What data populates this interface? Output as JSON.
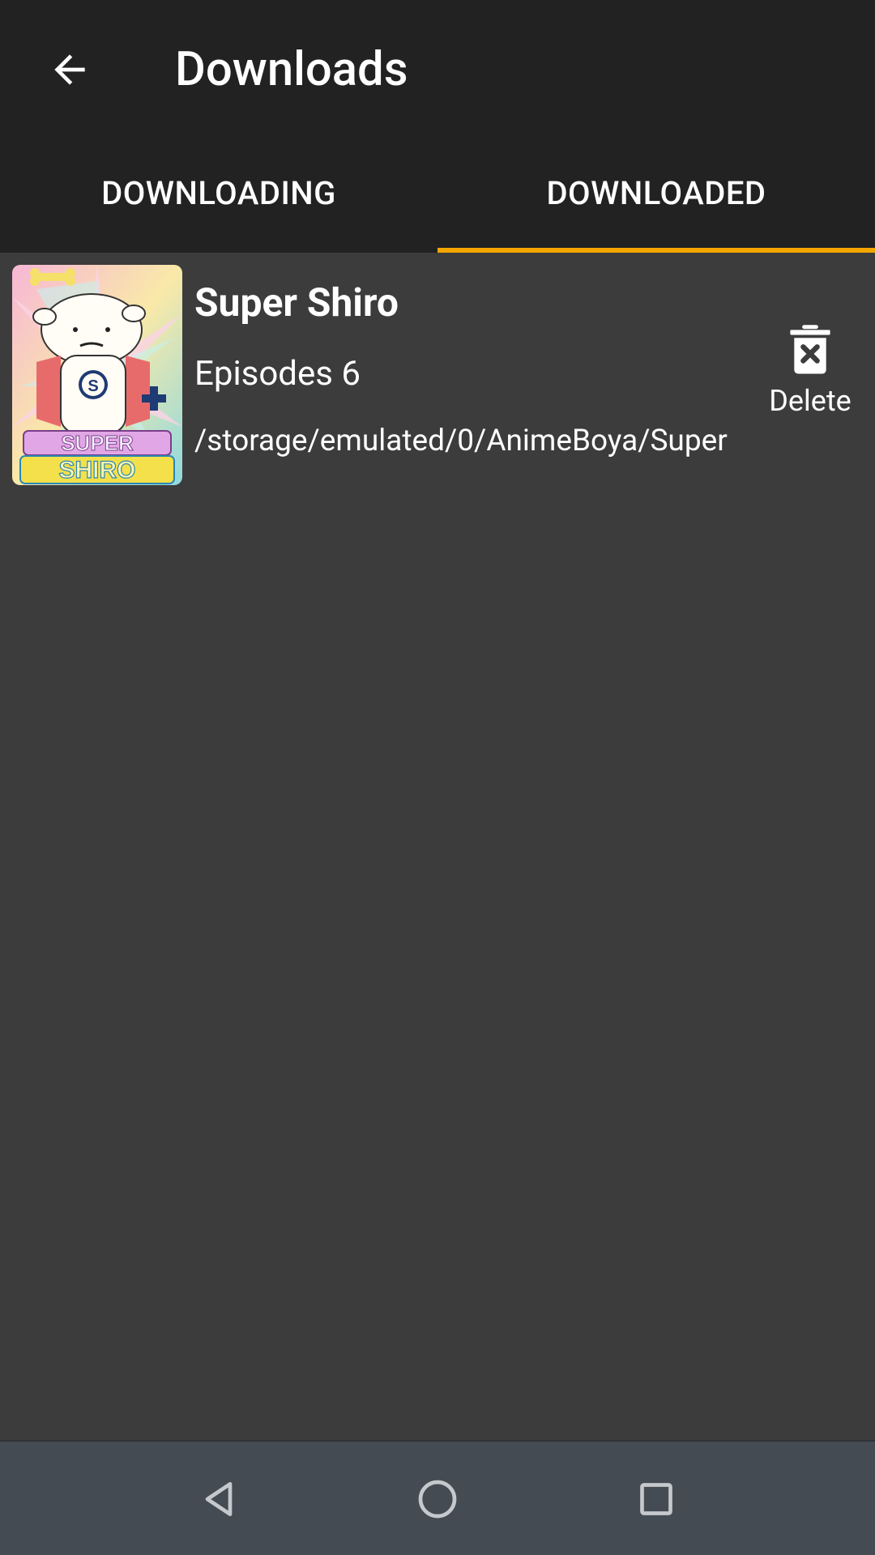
{
  "toolbar": {
    "title": "Downloads",
    "back_icon": "arrow-back-icon"
  },
  "tabs": [
    {
      "label": "DOWNLOADING",
      "active": false
    },
    {
      "label": "DOWNLOADED",
      "active": true
    }
  ],
  "accent_color": "#f5a500",
  "downloads": [
    {
      "title": "Super Shiro",
      "episodes": "Episodes 6",
      "path": "/storage/emulated/0/AnimeBoya/Super",
      "poster_logo_top": "SUPER",
      "poster_logo_bottom": "SHIRO",
      "poster_badge": "S",
      "delete_label": "Delete",
      "delete_icon": "trash-x-icon"
    }
  ],
  "navigation": {
    "back_icon": "nav-back-triangle-icon",
    "home_icon": "nav-home-circle-icon",
    "recents_icon": "nav-recents-square-icon"
  }
}
